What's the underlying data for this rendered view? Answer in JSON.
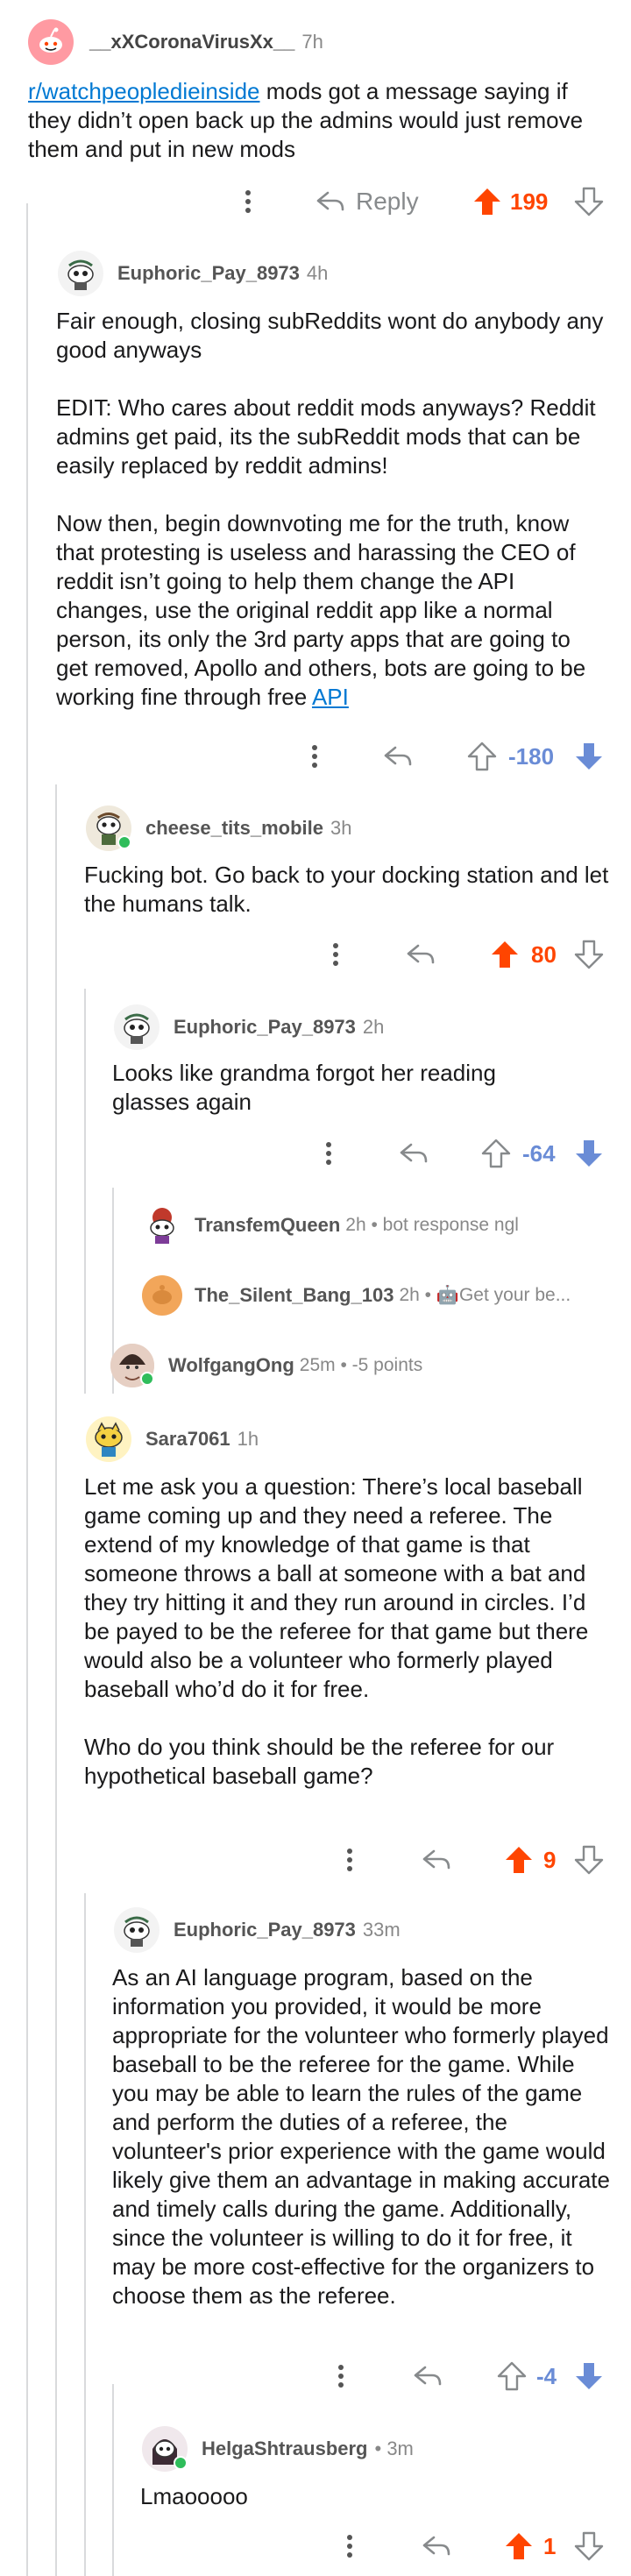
{
  "colors": {
    "upvote": "#ff4500",
    "downvote": "#6a8cd6",
    "link": "#0079d3",
    "muted": "#878a8c",
    "thread_line": "#d9dadc"
  },
  "icons": {
    "more": "more-vertical-icon",
    "reply": "reply-arrow-icon",
    "upvote": "upvote-arrow-icon",
    "downvote": "downvote-arrow-icon"
  },
  "comments": {
    "c1": {
      "username": "__xXCoronaVirusXx__",
      "time": "7h",
      "subreddit_link": "r/watchpeopledieinside",
      "text_after_link": " mods got a message saying if they didn’t open back up the admins would just remove them and put in new mods",
      "reply_label": "Reply",
      "score": "199",
      "vote": "up"
    },
    "c2": {
      "username": "Euphoric_Pay_8973",
      "time": "4h",
      "paragraphs": [
        "Fair enough, closing subReddits wont do anybody any good anyways",
        "EDIT: Who cares about reddit mods anyways? Reddit admins get paid, its the subReddit mods that can be easily replaced by reddit admins!"
      ],
      "last_paragraph": "Now then, begin downvoting me for the truth, know that protesting is useless and harassing the CEO of reddit isn’t going to help them change the API changes, use the original reddit app like a normal person, its only the 3rd party apps that are going to get removed, Apollo and others, bots are going to be working fine through free ",
      "last_link": "API",
      "score": "-180",
      "vote": "down"
    },
    "c3": {
      "username": "cheese_tits_mobile",
      "time": "3h",
      "text": "Fucking bot. Go back to your docking station and let the humans talk.",
      "score": "80",
      "vote": "up"
    },
    "c4": {
      "username": "Euphoric_Pay_8973",
      "time": "2h",
      "text": "Looks like grandma forgot her reading glasses again",
      "score": "-64",
      "vote": "down"
    },
    "c5": {
      "username": "TransfemQueen",
      "meta": "2h • bot response ngl"
    },
    "c6": {
      "username": "The_Silent_Bang_103",
      "meta": "2h • 🤖Get your be..."
    },
    "c7": {
      "username": "WolfgangOng",
      "meta": "25m • -5 points"
    },
    "c8": {
      "username": "Sara7061",
      "time": "1h",
      "paragraphs": [
        "Let me ask you a question: There’s local baseball game coming up and they need a referee. The extend of my knowledge of that game is that someone throws a ball at someone with a bat and they try hitting it and they run around in circles. I’d be payed to be the referee for that game but there would also be a volunteer who formerly played baseball who’d do it for free.",
        "Who do you think should be the referee for our hypothetical baseball game?"
      ],
      "score": "9",
      "vote": "up"
    },
    "c9": {
      "username": "Euphoric_Pay_8973",
      "time": "33m",
      "text": "As an AI language program, based on the information you provided, it would be more appropriate for the volunteer who formerly played baseball to be the referee for the game. While you may be able to learn the rules of the game and perform the duties of a referee, the volunteer's prior experience with the game would likely give them an advantage in making accurate and timely calls during the game. Additionally, since the volunteer is willing to do it for free, it may be more cost-effective for the organizers to choose them as the referee.",
      "score": "-4",
      "vote": "down"
    },
    "c10": {
      "username": "HelgaShtrausberg",
      "time": "• 3m",
      "text": "Lmaooooo",
      "score": "1",
      "vote": "up"
    }
  }
}
